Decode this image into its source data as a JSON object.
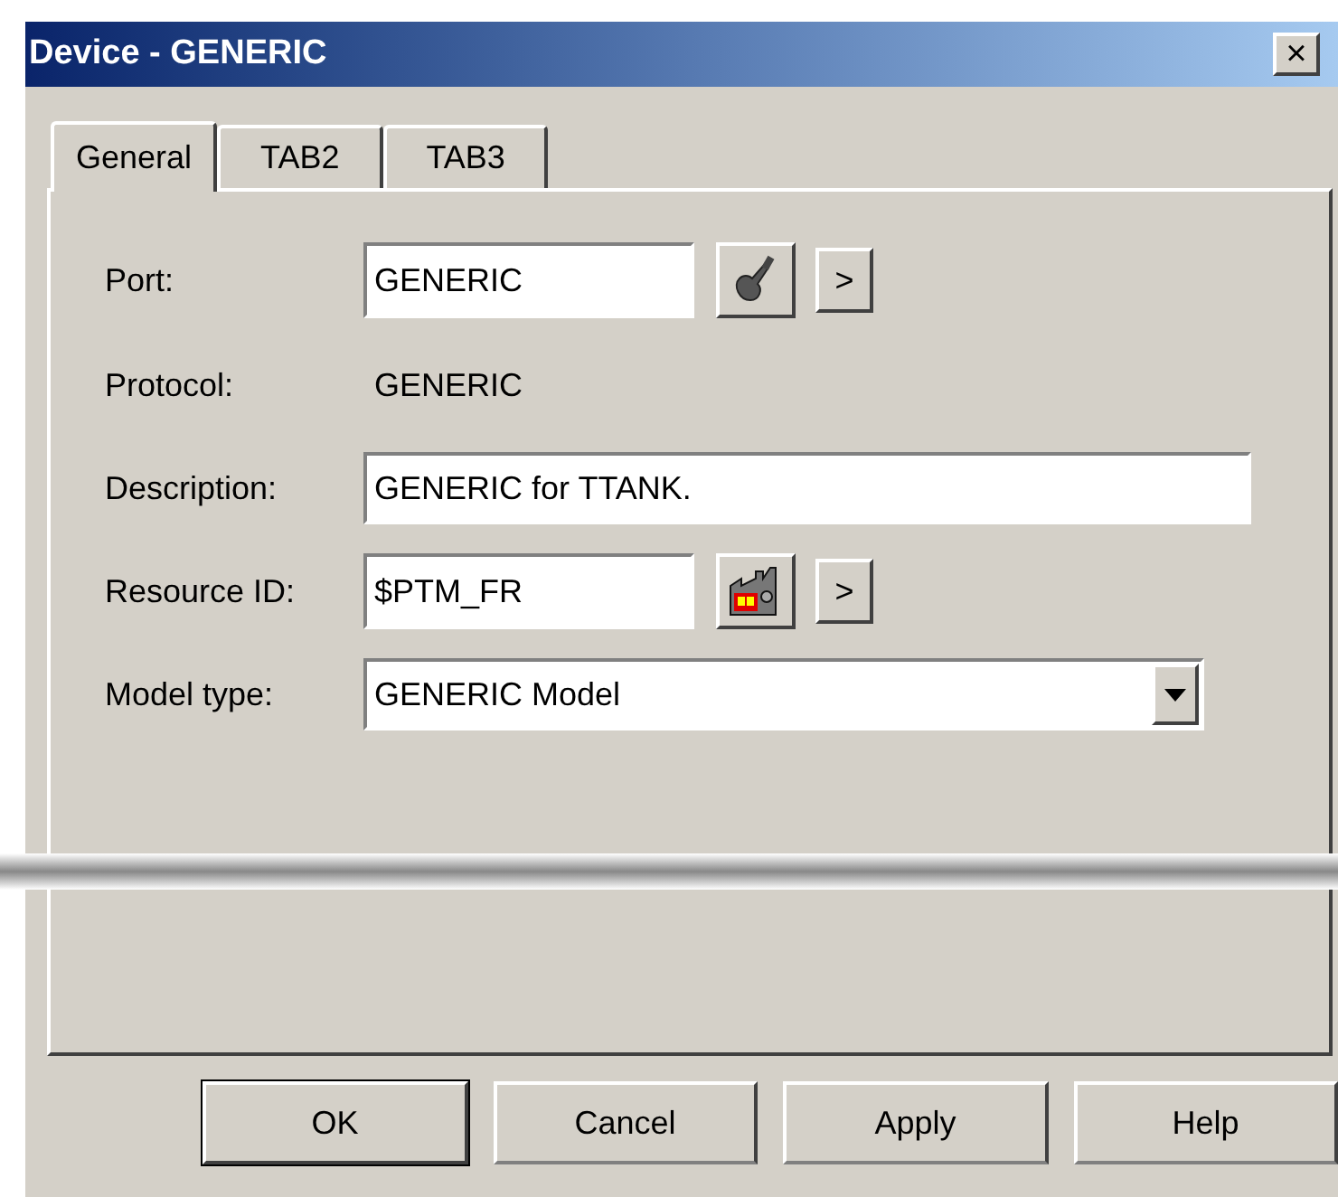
{
  "window": {
    "title": "Device - GENERIC",
    "close": "×"
  },
  "tabs": [
    {
      "label": "General",
      "selected": true
    },
    {
      "label": "TAB2",
      "selected": false
    },
    {
      "label": "TAB3",
      "selected": false
    }
  ],
  "fields": [
    {
      "kind": "text",
      "label": "Port:",
      "value": "GENERIC",
      "more": ">"
    },
    {
      "kind": "static",
      "label": "Protocol:",
      "value": "GENERIC"
    },
    {
      "kind": "wide",
      "label": "Description:",
      "value": "GENERIC for TTANK."
    },
    {
      "kind": "text",
      "label": "Resource ID:",
      "value": "$PTM_FR",
      "more": ">"
    },
    {
      "kind": "combo",
      "label": "Model type:",
      "value": "GENERIC Model"
    }
  ],
  "buttons": [
    {
      "label": "OK",
      "default": true
    },
    {
      "label": "Cancel",
      "default": false
    },
    {
      "label": "Apply",
      "default": false
    },
    {
      "label": "Help",
      "default": false
    }
  ]
}
